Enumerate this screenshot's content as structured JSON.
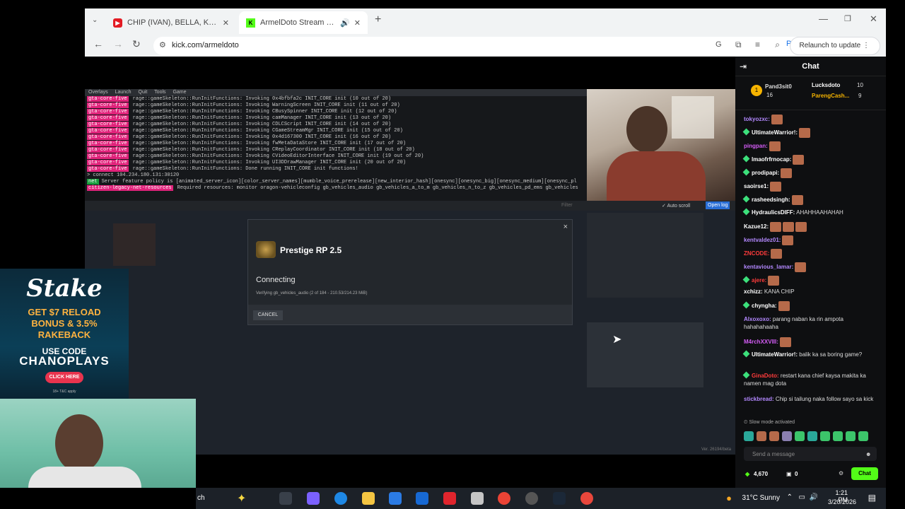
{
  "browser": {
    "tabs": [
      {
        "title": "CHIP (IVAN), BELLA, KLAY & CH",
        "fav_color": "#e31b23",
        "fav_icon": "youtube-icon"
      },
      {
        "title": "ArmelDoto Stream - Watch",
        "fav_color": "#53fc18",
        "fav_icon": "kick-icon",
        "audio": "🔊"
      }
    ],
    "url": "kick.com/armeldoto",
    "relaunch_label": "Relaunch to update",
    "new_tab": "+"
  },
  "console": {
    "menu": [
      "Overlays",
      "Launch",
      "Quit",
      "Tools",
      "Game"
    ],
    "tag": "gta-core-five",
    "lines": [
      "rage::gameSkeleton::RunInitFunctions: Invoking 0x4bfbfa2c INIT_CORE init (10 out of 20)",
      "rage::gameSkeleton::RunInitFunctions: Invoking WarningScreen INIT_CORE init (11 out of 20)",
      "rage::gameSkeleton::RunInitFunctions: Invoking CBusySpinner INIT_CORE init (12 out of 20)",
      "rage::gameSkeleton::RunInitFunctions: Invoking camManager INIT_CORE init (13 out of 20)",
      "rage::gameSkeleton::RunInitFunctions: Invoking CDLCScript INIT_CORE init (14 out of 20)",
      "rage::gameSkeleton::RunInitFunctions: Invoking CGameStreamMgr INIT_CORE init (15 out of 20)",
      "rage::gameSkeleton::RunInitFunctions: Invoking 0x4d167300 INIT_CORE init (16 out of 20)",
      "rage::gameSkeleton::RunInitFunctions: Invoking fwMetaDataStore INIT_CORE init (17 out of 20)",
      "rage::gameSkeleton::RunInitFunctions: Invoking CReplayCoordinator INIT_CORE init (18 out of 20)",
      "rage::gameSkeleton::RunInitFunctions: Invoking CVideoEditorInterface INIT_CORE init (19 out of 20)",
      "rage::gameSkeleton::RunInitFunctions: Invoking UI3DDrawManager INIT_CORE init (20 out of 20)",
      "rage::gameSkeleton::RunInitFunctions: Done running INIT_CORE init functions!"
    ],
    "connect": "> connect 104.234.180.131:30120",
    "policy_tag": "net",
    "policy": "Server feature policy is [animated_server_icon][color_server_names][mumble_voice_prerelease][new_interior_hash][onesync][onesync_big][onesync_medium][onesync_pl",
    "resources_tag": "citizen-legacy-net-resources",
    "resources": "Required resources: monitor oragon-vehicleconfig gb_vehicles_audio gb_vehicles_a_to_m gb_vehicles_n_to_z gb_vehicles_pd_ems gb_vehicles",
    "filter": "Filter",
    "autoscroll": "Auto scroll",
    "openlog": "Open log"
  },
  "dialog": {
    "title": "Prestige RP 2.5",
    "status": "Connecting",
    "detail": "Verifying gb_vehicles_audio (2 of 184 - 210.53/214.23 MiB)",
    "cancel": "CANCEL",
    "close": "×"
  },
  "game": {
    "version": "Ver. 26194/beta"
  },
  "stake": {
    "logo": "Stake",
    "line1": "GET $7 RELOAD",
    "line2": "BONUS & 3.5%",
    "line3": "RAKEBACK",
    "code_label": "USE CODE",
    "code": "CHANOPLAYS",
    "button": "CLICK HERE",
    "small": "18+ T&C apply"
  },
  "chat": {
    "title": "Chat",
    "top_gifters": [
      {
        "name": "Pand3sit0",
        "count": "16"
      },
      {
        "name": "Lucksdoto",
        "count": "10"
      },
      {
        "name": "ParengCash...",
        "count": "9"
      }
    ],
    "messages": [
      {
        "user": "tokyozxc:",
        "color": "#b388ff",
        "text": "",
        "emotes": 1,
        "badge": false
      },
      {
        "user": "UltimateWarrior!:",
        "color": "#ffffff",
        "text": "",
        "emotes": 1,
        "badge": true
      },
      {
        "user": "pingpan:",
        "color": "#d35cf5",
        "text": "",
        "emotes": 1,
        "badge": false
      },
      {
        "user": "lmaofrfrnocap:",
        "color": "#ffffff",
        "text": "",
        "emotes": 1,
        "badge": true
      },
      {
        "user": "prodipapi:",
        "color": "#ffffff",
        "text": "",
        "emotes": 1,
        "badge": true
      },
      {
        "user": "saoirse1:",
        "color": "#ffffff",
        "text": "",
        "emotes": 1,
        "badge": false
      },
      {
        "user": "rasheedsingh:",
        "color": "#ffffff",
        "text": "",
        "emotes": 1,
        "badge": true
      },
      {
        "user": "HydraulicsDIFF:",
        "color": "#ffffff",
        "text": "AHAHHAAHAHAH",
        "emotes": 0,
        "badge": true
      },
      {
        "user": "Kazue12:",
        "color": "#ffffff",
        "text": "",
        "emotes": 3,
        "badge": false
      },
      {
        "user": "kentvaldez01:",
        "color": "#b388ff",
        "text": "",
        "emotes": 1,
        "badge": false
      },
      {
        "user": "ZNCODE:",
        "color": "#ff3b3b",
        "text": "",
        "emotes": 1,
        "badge": false
      },
      {
        "user": "kentavious_lamar:",
        "color": "#b388ff",
        "text": "",
        "emotes": 1,
        "badge": false
      },
      {
        "user": "ajere:",
        "color": "#ff3b3b",
        "text": "",
        "emotes": 1,
        "badge": true
      },
      {
        "user": "xchizz:",
        "color": "#ffffff",
        "text": "KANA CHIP",
        "emotes": 0,
        "badge": false
      },
      {
        "user": "chyngha:",
        "color": "#ffffff",
        "text": "",
        "emotes": 1,
        "badge": true
      },
      {
        "user": "Alxoxoxo:",
        "color": "#b388ff",
        "text": "parang naban ka rin ampota hahahahaaha",
        "emotes": 0,
        "badge": false
      },
      {
        "user": "M4rchXXVIII:",
        "color": "#d35cf5",
        "text": "",
        "emotes": 1,
        "badge": false
      },
      {
        "user": "UltimateWarrior!:",
        "color": "#ffffff",
        "text": "balik ka sa boring game?",
        "emotes": 0,
        "badge": true
      },
      {
        "user": "GinaDoto:",
        "color": "#ff3b3b",
        "text": "restart kana chief kaysa makita ka namen mag dota",
        "emotes": 0,
        "badge": true
      },
      {
        "user": "stickbread:",
        "color": "#b388ff",
        "text": "Chip si tailung naka follow sayo sa kick",
        "emotes": 0,
        "badge": false
      }
    ],
    "slow_mode": "Slow mode activated",
    "input_placeholder": "Send a message",
    "points": "4,670",
    "points2": "0",
    "send_label": "Chat"
  },
  "taskbar": {
    "search_frag": "ch",
    "weather": "31°C  Sunny",
    "time": "1:21 PM",
    "date": "3/20/2026"
  }
}
